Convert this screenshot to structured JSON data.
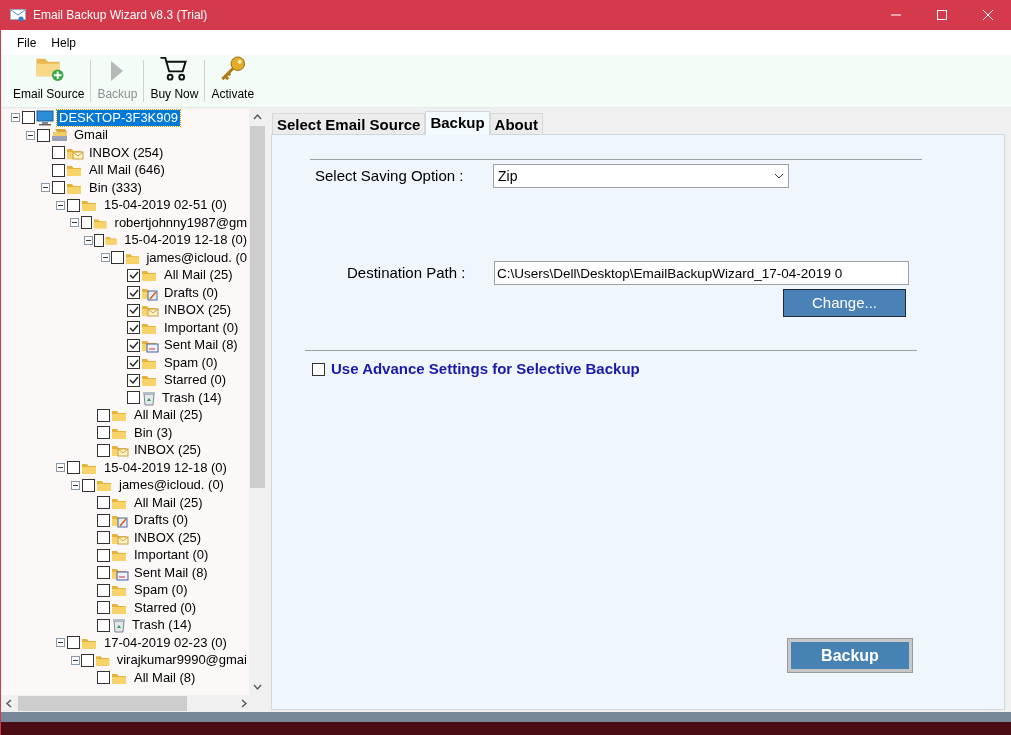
{
  "window": {
    "title": "Email Backup Wizard v8.3 (Trial)"
  },
  "menu": [
    "File",
    "Help"
  ],
  "toolbar": [
    {
      "kind": "source",
      "label": "Email Source",
      "disabled": false
    },
    {
      "kind": "backup",
      "label": "Backup",
      "disabled": true
    },
    {
      "kind": "buy",
      "label": "Buy Now",
      "disabled": false
    },
    {
      "kind": "activate",
      "label": "Activate",
      "disabled": false
    }
  ],
  "tree": [
    {
      "kind": "computer",
      "label": "DESKTOP-3F3K909",
      "selected": true,
      "checked": false,
      "expanded": true,
      "children": [
        {
          "kind": "account",
          "label": "Gmail",
          "selected": false,
          "checked": false,
          "expanded": true,
          "children": [
            {
              "kind": "inbox",
              "label": "INBOX (254)",
              "selected": false,
              "checked": false
            },
            {
              "kind": "folder",
              "label": "All Mail (646)",
              "selected": false,
              "checked": false
            },
            {
              "kind": "folder",
              "label": "Bin (333)",
              "selected": false,
              "checked": false,
              "expanded": true,
              "children": [
                {
                  "kind": "folder",
                  "label": "15-04-2019 02-51 (0)",
                  "selected": false,
                  "checked": false,
                  "expanded": true,
                  "children": [
                    {
                      "kind": "folder",
                      "label": "robertjohnny1987@gm",
                      "selected": false,
                      "checked": false,
                      "expanded": true,
                      "children": [
                        {
                          "kind": "folder",
                          "label": "15-04-2019 12-18 (0)",
                          "selected": false,
                          "checked": false,
                          "expanded": true,
                          "children": [
                            {
                              "kind": "folder",
                              "label": "james@icloud. (0",
                              "selected": false,
                              "checked": false,
                              "expanded": true,
                              "children": [
                                {
                                  "kind": "folder",
                                  "label": "All Mail (25)",
                                  "selected": false,
                                  "checked": true
                                },
                                {
                                  "kind": "drafts",
                                  "label": "Drafts (0)",
                                  "selected": false,
                                  "checked": true
                                },
                                {
                                  "kind": "inbox",
                                  "label": "INBOX (25)",
                                  "selected": false,
                                  "checked": true
                                },
                                {
                                  "kind": "folder",
                                  "label": "Important (0)",
                                  "selected": false,
                                  "checked": true
                                },
                                {
                                  "kind": "sent",
                                  "label": "Sent Mail (8)",
                                  "selected": false,
                                  "checked": true
                                },
                                {
                                  "kind": "folder",
                                  "label": "Spam (0)",
                                  "selected": false,
                                  "checked": true
                                },
                                {
                                  "kind": "folder",
                                  "label": "Starred (0)",
                                  "selected": false,
                                  "checked": true
                                },
                                {
                                  "kind": "trash",
                                  "label": "Trash (14)",
                                  "selected": false,
                                  "checked": false
                                }
                              ]
                            }
                          ]
                        },
                        {
                          "kind": "folder",
                          "label": "All Mail (25)",
                          "selected": false,
                          "checked": false
                        },
                        {
                          "kind": "folder",
                          "label": "Bin (3)",
                          "selected": false,
                          "checked": false
                        },
                        {
                          "kind": "inbox",
                          "label": "INBOX (25)",
                          "selected": false,
                          "checked": false
                        }
                      ]
                    }
                  ]
                },
                {
                  "kind": "folder",
                  "label": "15-04-2019 12-18 (0)",
                  "selected": false,
                  "checked": false,
                  "expanded": true,
                  "children": [
                    {
                      "kind": "folder",
                      "label": "james@icloud. (0)",
                      "selected": false,
                      "checked": false,
                      "expanded": true,
                      "children": [
                        {
                          "kind": "folder",
                          "label": "All Mail (25)",
                          "selected": false,
                          "checked": false
                        },
                        {
                          "kind": "drafts",
                          "label": "Drafts (0)",
                          "selected": false,
                          "checked": false
                        },
                        {
                          "kind": "inbox",
                          "label": "INBOX (25)",
                          "selected": false,
                          "checked": false
                        },
                        {
                          "kind": "folder",
                          "label": "Important (0)",
                          "selected": false,
                          "checked": false
                        },
                        {
                          "kind": "sent",
                          "label": "Sent Mail (8)",
                          "selected": false,
                          "checked": false
                        },
                        {
                          "kind": "folder",
                          "label": "Spam (0)",
                          "selected": false,
                          "checked": false
                        },
                        {
                          "kind": "folder",
                          "label": "Starred (0)",
                          "selected": false,
                          "checked": false
                        },
                        {
                          "kind": "trash",
                          "label": "Trash (14)",
                          "selected": false,
                          "checked": false
                        }
                      ]
                    }
                  ]
                },
                {
                  "kind": "folder",
                  "label": "17-04-2019 02-23 (0)",
                  "selected": false,
                  "checked": false,
                  "expanded": true,
                  "children": [
                    {
                      "kind": "folder",
                      "label": "virajkumar9990@gmai",
                      "selected": false,
                      "checked": false,
                      "expanded": true,
                      "children": [
                        {
                          "kind": "folder",
                          "label": "All Mail (8)",
                          "selected": false,
                          "checked": false
                        }
                      ]
                    }
                  ]
                }
              ]
            }
          ]
        }
      ]
    }
  ],
  "tabs": [
    {
      "label": "Select Email Source",
      "selected": false
    },
    {
      "label": "Backup",
      "selected": true
    },
    {
      "label": "About",
      "selected": false
    }
  ],
  "backup": {
    "saving_option_label": "Select Saving Option :",
    "saving_option": "Zip",
    "destination_label": "Destination Path :",
    "destination": "C:\\Users\\Dell\\Desktop\\EmailBackupWizard_17-04-2019 0",
    "change_button": "Change...",
    "advanced": {
      "label": "Use Advance Settings for Selective Backup",
      "checked": false
    },
    "backup_button": "Backup"
  }
}
